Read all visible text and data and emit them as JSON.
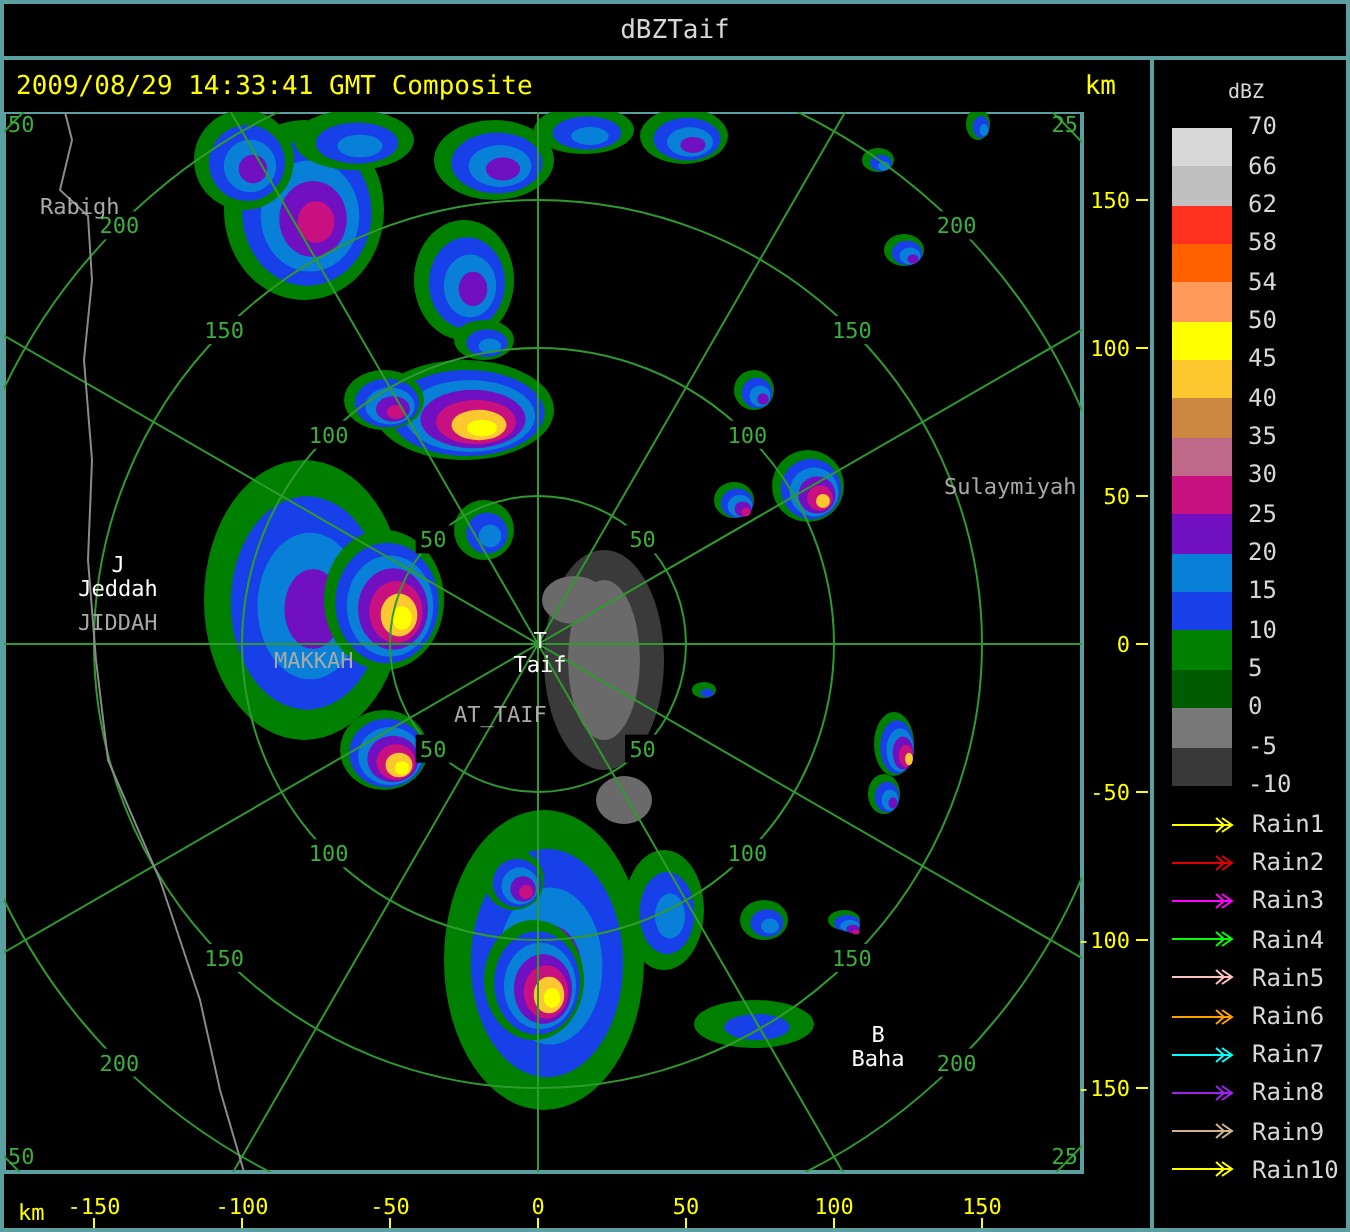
{
  "window": {
    "title": "dBZTaif"
  },
  "header": {
    "title": "2009/08/29 14:33:41 GMT Composite",
    "unit": "km"
  },
  "range_labels": {
    "northwest": [
      "50",
      "100",
      "150",
      "200"
    ],
    "northeast": [
      "50",
      "100",
      "150",
      "200"
    ],
    "southeast": [
      "50",
      "100",
      "150",
      "200"
    ],
    "southwest": [
      "50",
      "100",
      "150",
      "200"
    ]
  },
  "corner_labels": [
    "50",
    "25",
    "50",
    "25"
  ],
  "map_labels": [
    {
      "kind": "place",
      "name": "Rabigh"
    },
    {
      "kind": "site",
      "marker": "J",
      "name": "Jeddah"
    },
    {
      "kind": "place",
      "name": "JIDDAH"
    },
    {
      "kind": "place",
      "name": "MAKKAH"
    },
    {
      "kind": "site",
      "marker": "T",
      "name": "Taif"
    },
    {
      "kind": "place",
      "name": "AT_TAIF"
    },
    {
      "kind": "place",
      "name": "Sulaymiyah"
    },
    {
      "kind": "site",
      "marker": "B",
      "name": "Baha"
    }
  ],
  "y_axis": {
    "ticks": [
      "150",
      "100",
      "50",
      "0",
      "-50",
      "-100",
      "-150"
    ]
  },
  "x_axis": {
    "unit": "km",
    "ticks": [
      "-150",
      "-100",
      "-50",
      "0",
      "50",
      "100",
      "150"
    ]
  },
  "color_scale": {
    "unit": "dBZ",
    "bands": [
      {
        "color": "#d8d8d8"
      },
      {
        "color": "#c0c0c0"
      },
      {
        "color": "#ff3020"
      },
      {
        "color": "#ff6000"
      },
      {
        "color": "#ff9a5a"
      },
      {
        "color": "#ffff00"
      },
      {
        "color": "#fcc830"
      },
      {
        "color": "#cc8840"
      },
      {
        "color": "#c06888"
      },
      {
        "color": "#c81080"
      },
      {
        "color": "#7010c0"
      },
      {
        "color": "#0880d8"
      },
      {
        "color": "#1840e8"
      },
      {
        "color": "#008000"
      },
      {
        "color": "#005c00"
      },
      {
        "color": "#787878"
      },
      {
        "color": "#383838"
      }
    ],
    "labels": [
      "70",
      "66",
      "62",
      "58",
      "54",
      "50",
      "45",
      "40",
      "35",
      "30",
      "25",
      "20",
      "15",
      "10",
      "5",
      "0",
      "-5",
      "-10"
    ]
  },
  "rain_tracks": [
    {
      "label": "Rain1",
      "color": "#ffff00"
    },
    {
      "label": "Rain2",
      "color": "#e00000"
    },
    {
      "label": "Rain3",
      "color": "#ff00ff"
    },
    {
      "label": "Rain4",
      "color": "#00ff00"
    },
    {
      "label": "Rain5",
      "color": "#ffc0c0"
    },
    {
      "label": "Rain6",
      "color": "#ffa000"
    },
    {
      "label": "Rain7",
      "color": "#00ffff"
    },
    {
      "label": "Rain8",
      "color": "#a020f0"
    },
    {
      "label": "Rain9",
      "color": "#d2b48c"
    },
    {
      "label": "Rain10",
      "color": "#ffff00"
    }
  ]
}
